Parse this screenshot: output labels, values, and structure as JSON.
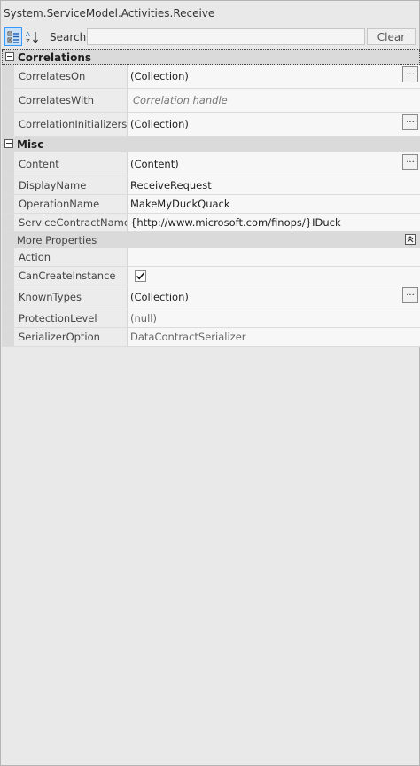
{
  "window": {
    "title": "System.ServiceModel.Activities.Receive"
  },
  "toolbar": {
    "search_label": "Search:",
    "search_value": "",
    "clear_label": "Clear",
    "categorized_icon": "categorized-icon",
    "alphabetical_icon": "sort-alphabetical-icon"
  },
  "categories": [
    {
      "label": "Correlations",
      "properties": [
        {
          "name": "CorrelatesOn",
          "value": "(Collection)"
        },
        {
          "name": "CorrelatesWith",
          "value": "Correlation handle"
        },
        {
          "name": "CorrelationInitializers",
          "value": "(Collection)"
        }
      ]
    },
    {
      "label": "Misc",
      "properties": [
        {
          "name": "Content",
          "value": "(Content)"
        },
        {
          "name": "DisplayName",
          "value": "ReceiveRequest"
        },
        {
          "name": "OperationName",
          "value": "MakeMyDuckQuack"
        },
        {
          "name": "ServiceContractName",
          "value": "{http://www.microsoft.com/finops/}IDuck"
        }
      ]
    }
  ],
  "more_properties": {
    "label": "More Properties",
    "properties": [
      {
        "name": "Action",
        "value": ""
      },
      {
        "name": "CanCreateInstance",
        "checked": true
      },
      {
        "name": "KnownTypes",
        "value": "(Collection)"
      },
      {
        "name": "ProtectionLevel",
        "value": "(null)"
      },
      {
        "name": "SerializerOption",
        "value": "DataContractSerializer"
      }
    ]
  },
  "ellipsis_label": "..."
}
